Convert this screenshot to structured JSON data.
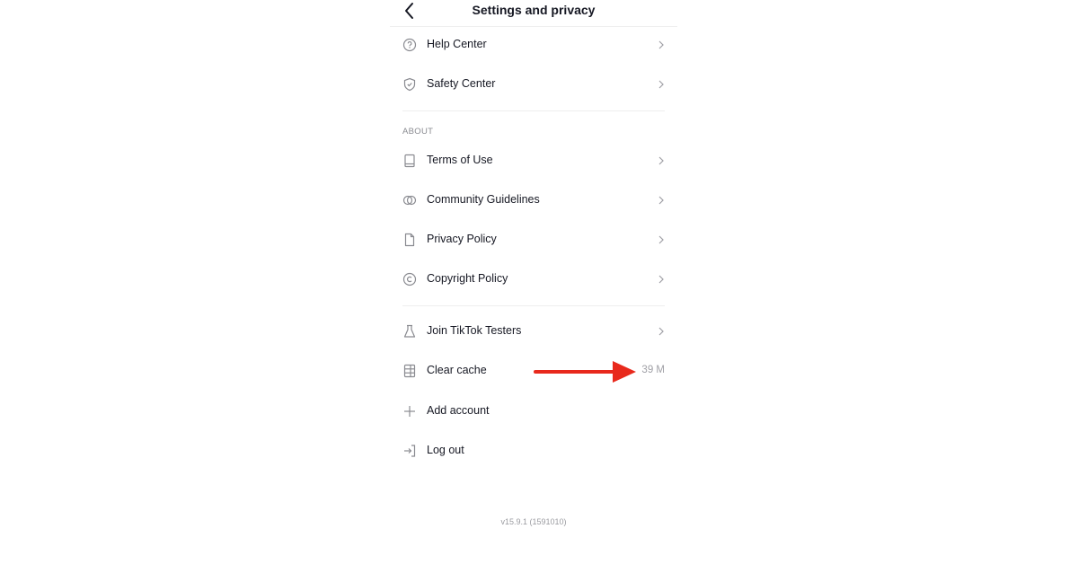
{
  "header": {
    "title": "Settings and privacy",
    "back_icon": "chevron-left-icon"
  },
  "support_items": [
    {
      "label": "Help Center",
      "icon": "question-circle-icon"
    },
    {
      "label": "Safety Center",
      "icon": "shield-check-icon"
    }
  ],
  "about": {
    "section_label": "ABOUT",
    "items": [
      {
        "label": "Terms of Use",
        "icon": "book-icon"
      },
      {
        "label": "Community Guidelines",
        "icon": "guidelines-icon"
      },
      {
        "label": "Privacy Policy",
        "icon": "document-icon"
      },
      {
        "label": "Copyright Policy",
        "icon": "copyright-icon"
      }
    ]
  },
  "misc_items": [
    {
      "label": "Join TikTok Testers",
      "icon": "flask-icon"
    },
    {
      "label": "Clear cache",
      "icon": "storage-icon",
      "value": "39 M"
    },
    {
      "label": "Add account",
      "icon": "plus-icon"
    },
    {
      "label": "Log out",
      "icon": "logout-icon"
    }
  ],
  "version": "v15.9.1 (1591010)",
  "annotation": {
    "arrow_color": "#e8291c"
  }
}
